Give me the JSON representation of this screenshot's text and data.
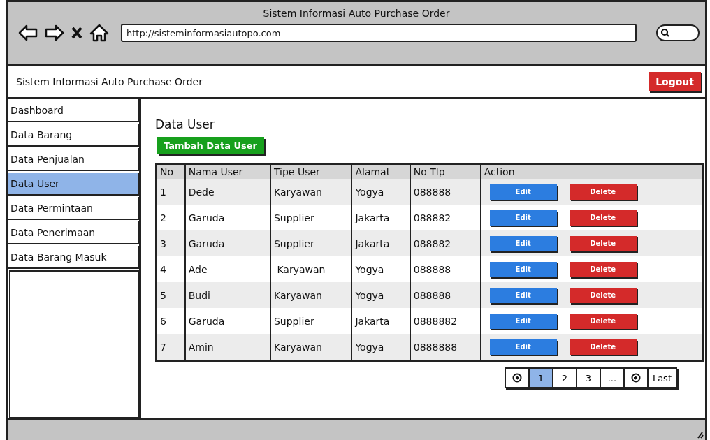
{
  "browser": {
    "title": "Sistem Informasi Auto Purchase Order",
    "url": "http://sisteminformasiautopo.com"
  },
  "header": {
    "title": "Sistem Informasi Auto Purchase Order",
    "logout": "Logout"
  },
  "sidebar": {
    "items": [
      {
        "label": "Dashboard",
        "selected": false
      },
      {
        "label": "Data Barang",
        "selected": false
      },
      {
        "label": "Data Penjualan",
        "selected": false
      },
      {
        "label": "Data User",
        "selected": true
      },
      {
        "label": "Data Permintaan",
        "selected": false
      },
      {
        "label": "Data Penerimaan",
        "selected": false
      },
      {
        "label": "Data Barang Masuk",
        "selected": false
      }
    ]
  },
  "page": {
    "title": "Data User",
    "add_button": "Tambah Data User"
  },
  "table": {
    "columns": [
      "No",
      "Nama User",
      "Tipe User",
      "Alamat",
      "No Tlp",
      "Action"
    ],
    "rows": [
      {
        "cells": [
          "1",
          "Dede",
          "Karyawan",
          "Yogya",
          "088888"
        ],
        "edit": "Edit",
        "delete": "Delete"
      },
      {
        "cells": [
          "2",
          "Garuda",
          "Supplier",
          "Jakarta",
          "088882"
        ],
        "edit": "Edit",
        "delete": "Delete"
      },
      {
        "cells": [
          "3",
          "Garuda",
          "Supplier",
          "Jakarta",
          "088882"
        ],
        "edit": "Edit",
        "delete": "Delete"
      },
      {
        "cells": [
          "4",
          "Ade",
          " Karyawan",
          "Yogya",
          "088888"
        ],
        "edit": "Edit",
        "delete": "Delete"
      },
      {
        "cells": [
          "5",
          "Budi",
          "Karyawan",
          "Yogya",
          "088888"
        ],
        "edit": "Edit",
        "delete": "Delete"
      },
      {
        "cells": [
          "6",
          "Garuda",
          "Supplier",
          "Jakarta",
          "0888882"
        ],
        "edit": "Edit",
        "delete": "Delete"
      },
      {
        "cells": [
          "7",
          "Amin",
          "Karyawan",
          "Yogya",
          "0888888"
        ],
        "edit": "Edit",
        "delete": "Delete"
      }
    ]
  },
  "pagination": {
    "pages": [
      {
        "label": "1",
        "selected": true
      },
      {
        "label": "2",
        "selected": false
      },
      {
        "label": "3",
        "selected": false
      },
      {
        "label": "...",
        "selected": false
      }
    ],
    "last": "Last"
  }
}
